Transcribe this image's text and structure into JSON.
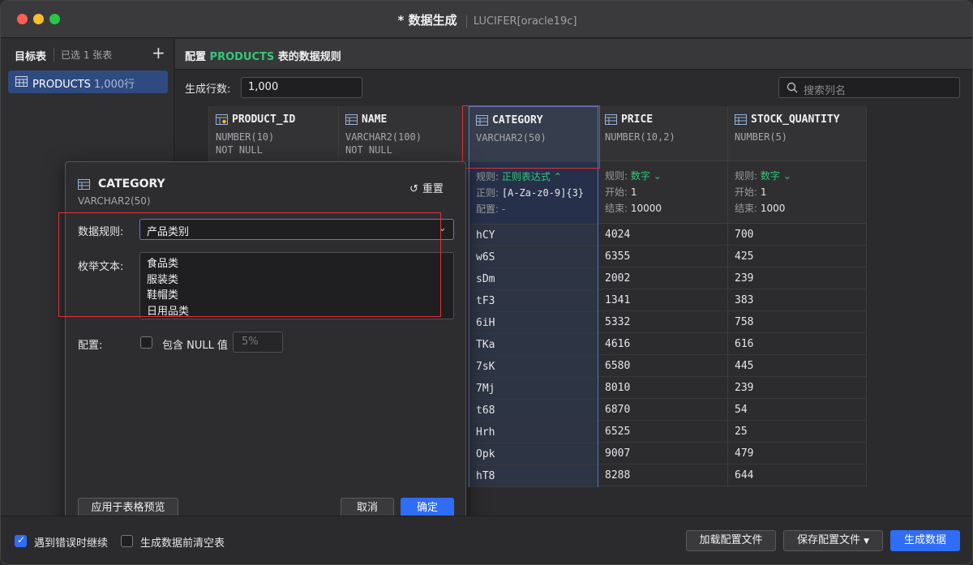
{
  "window": {
    "title": "* 数据生成",
    "subtitle": "LUCIFER[oracle19c]"
  },
  "sidebar": {
    "heading": "目标表",
    "selected_count": "已选 1 张表",
    "add_icon": "plus-icon",
    "items": [
      {
        "name": "PRODUCTS",
        "count": "1,000行",
        "icon": "table-icon"
      }
    ]
  },
  "main": {
    "header_prefix": "配置",
    "header_table": "PRODUCTS",
    "header_suffix": "表的数据规则",
    "rowcount_label": "生成行数:",
    "rowcount_value": "1,000",
    "search_placeholder": "搜索列名",
    "accent_color": "#32c77a"
  },
  "columns": [
    {
      "name": "PRODUCT_ID",
      "type": "NUMBER(10)",
      "constraint": "NOT NULL",
      "icon": "key-table-icon"
    },
    {
      "name": "NAME",
      "type": "VARCHAR2(100)",
      "constraint": "NOT NULL",
      "icon": "table-icon"
    },
    {
      "name": "CATEGORY",
      "type": "VARCHAR2(50)",
      "icon": "table-icon",
      "rule_label": "规则:",
      "rule_value": "正则表达式",
      "line2_label": "正则:",
      "line2_value": "[A-Za-z0-9]{3}",
      "line3_label": "配置:",
      "line3_value": "-",
      "cells": [
        "hCY",
        "w6S",
        "sDm",
        "tF3",
        "6iH",
        "TKa",
        "7sK",
        "7Mj",
        "t68",
        "Hrh",
        "Opk",
        "hT8"
      ]
    },
    {
      "name": "PRICE",
      "type": "NUMBER(10,2)",
      "icon": "table-icon",
      "rule_label": "规则:",
      "rule_value": "数字",
      "line2_label": "开始:",
      "line2_value": "1",
      "line3_label": "结束:",
      "line3_value": "10000",
      "cells": [
        "4024",
        "6355",
        "2002",
        "1341",
        "5332",
        "4616",
        "6580",
        "8010",
        "6870",
        "6525",
        "9007",
        "8288"
      ]
    },
    {
      "name": "STOCK_QUANTITY",
      "type": "NUMBER(5)",
      "icon": "table-icon",
      "rule_label": "规则:",
      "rule_value": "数字",
      "line2_label": "开始:",
      "line2_value": "1",
      "line3_label": "结束:",
      "line3_value": "1000",
      "cells": [
        "700",
        "425",
        "239",
        "383",
        "758",
        "616",
        "445",
        "239",
        "54",
        "25",
        "479",
        "644"
      ]
    }
  ],
  "dialog": {
    "title": "CATEGORY",
    "type": "VARCHAR2(50)",
    "reset_label": "重置",
    "rule_label": "数据规则:",
    "rule_value": "产品类别",
    "enum_label": "枚举文本:",
    "enum_lines": [
      "食品类",
      "服装类",
      "鞋帽类",
      "日用品类"
    ],
    "config_label": "配置:",
    "include_null_label": "包含 NULL 值",
    "null_percent": "5%",
    "apply_label": "应用于表格预览",
    "cancel_label": "取消",
    "ok_label": "确定"
  },
  "footer": {
    "continue_on_error_label": "遇到错误时继续",
    "continue_on_error_checked": true,
    "clear_before_label": "生成数据前清空表",
    "clear_before_checked": false,
    "load_config_label": "加载配置文件",
    "save_config_label": "保存配置文件",
    "generate_label": "生成数据",
    "primary_color": "#2f6df6"
  }
}
